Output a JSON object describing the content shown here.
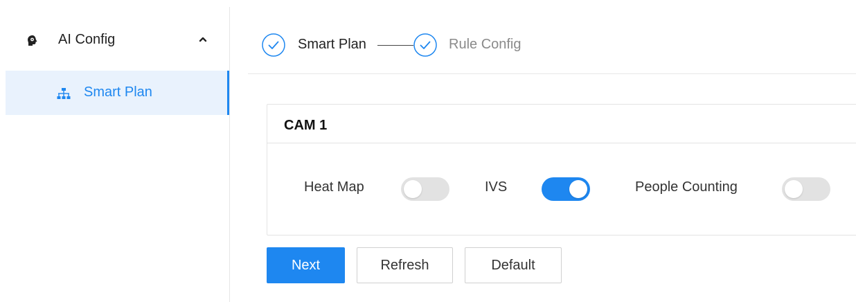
{
  "sidebar": {
    "group": {
      "label": "AI Config",
      "icon": "ai-head-icon",
      "expanded": true
    },
    "items": [
      {
        "label": "Smart Plan",
        "icon": "hierarchy-icon",
        "active": true
      }
    ]
  },
  "steps": [
    {
      "label": "Smart Plan",
      "state": "active"
    },
    {
      "label": "Rule Config",
      "state": "pending"
    }
  ],
  "panel": {
    "title": "CAM 1",
    "switches": [
      {
        "label": "Heat Map",
        "on": false
      },
      {
        "label": "IVS",
        "on": true
      },
      {
        "label": "People Counting",
        "on": false
      }
    ]
  },
  "buttons": {
    "next": "Next",
    "refresh": "Refresh",
    "default": "Default"
  },
  "colors": {
    "accent": "#1e87f0",
    "switch_off": "#e2e2e2",
    "active_bg": "#e9f2fd"
  }
}
